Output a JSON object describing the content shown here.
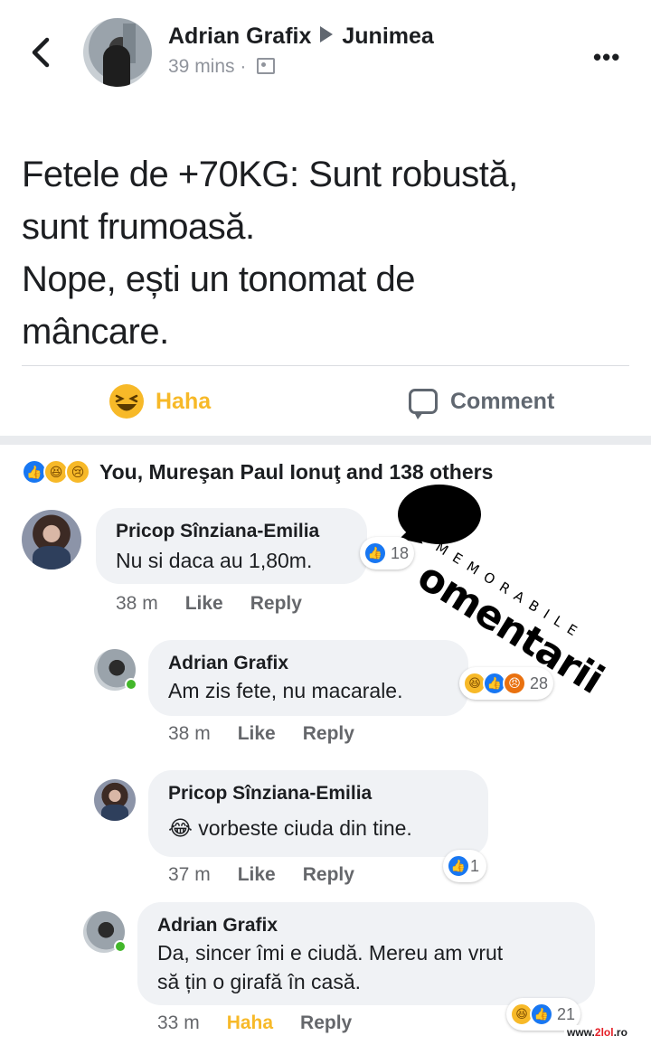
{
  "header": {
    "author": "Adrian Grafix",
    "group": "Junimea",
    "time": "39 mins",
    "separator": "·",
    "more": "•••"
  },
  "post": {
    "text_line1": "Fetele de +70KG: Sunt robustă,",
    "text_line2": "sunt frumoasă.",
    "text_line3": "Nope, ești un tonomat de",
    "text_line4": "mâncare."
  },
  "actions": {
    "haha_label": "Haha",
    "comment_label": "Comment"
  },
  "reactions_summary": "You, Mureşan Paul Ionuţ and 138 others",
  "comments": [
    {
      "name": "Pricop Sînziana-Emilia",
      "text": "Nu si daca au 1,80m.",
      "time": "38 m",
      "like": "Like",
      "reply": "Reply",
      "reaction_count": "18"
    },
    {
      "name": "Adrian Grafix",
      "text": "Am zis fete, nu macarale.",
      "time": "38 m",
      "like": "Like",
      "reply": "Reply",
      "reaction_count": "28"
    },
    {
      "name": "Pricop Sînziana-Emilia",
      "emoji": "😂",
      "text": "vorbeste ciuda din tine.",
      "time": "37 m",
      "like": "Like",
      "reply": "Reply",
      "reaction_count": "1"
    },
    {
      "name": "Adrian Grafix",
      "text_line1": "Da, sincer îmi e ciudă. Mereu am vrut",
      "text_line2": "să țin o girafă în casă.",
      "time": "33 m",
      "like": "Haha",
      "reply": "Reply",
      "reaction_count": "21"
    }
  ],
  "watermark": {
    "main": "omentarii",
    "sub": "MEMORABILE"
  },
  "site": {
    "prefix": "www.",
    "brand": "2lol",
    "suffix": ".ro"
  },
  "colors": {
    "facebook_blue": "#1877f2",
    "haha_yellow": "#f7b928",
    "angry_orange": "#e9710f",
    "bubble_gray": "#f0f2f5"
  },
  "icons": {
    "back": "chevron-left-icon",
    "audience": "group-audience-icon",
    "haha": "haha-emoji-icon",
    "comment": "speech-bubble-icon",
    "like": "like-thumb-icon"
  }
}
